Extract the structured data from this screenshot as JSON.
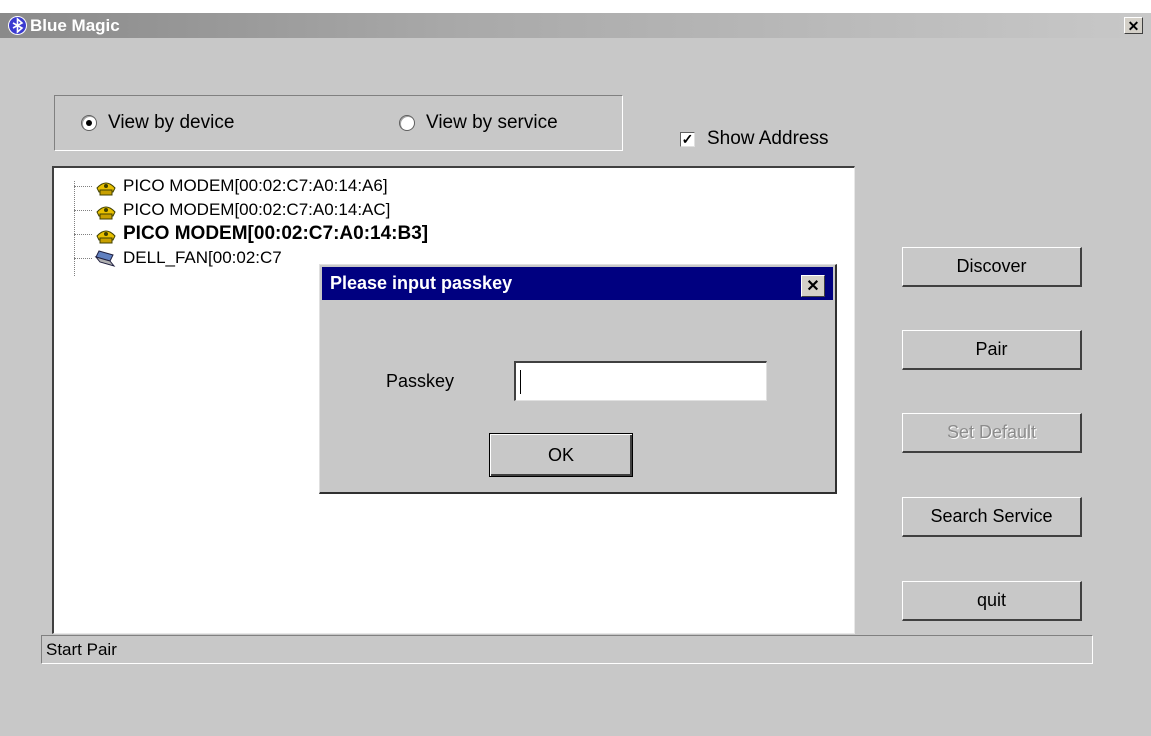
{
  "window": {
    "title": "Blue Magic",
    "close_label": "✕"
  },
  "view_options": {
    "by_device": "View by device",
    "by_service": "View by service",
    "selected": "View by device"
  },
  "show_address": {
    "label": "Show Address",
    "checked": true,
    "mark": "✓"
  },
  "devices": [
    {
      "label": "PICO MODEM[00:02:C7:A0:14:A6]",
      "icon": "modem-icon",
      "bold": false
    },
    {
      "label": "PICO MODEM[00:02:C7:A0:14:AC]",
      "icon": "modem-icon",
      "bold": false
    },
    {
      "label": "PICO MODEM[00:02:C7:A0:14:B3]",
      "icon": "modem-icon",
      "bold": true
    },
    {
      "label": "DELL_FAN[00:02:C7",
      "icon": "laptop-icon",
      "bold": false
    }
  ],
  "buttons": {
    "discover": "Discover",
    "pair": "Pair",
    "set_default": "Set Default",
    "search_service": "Search Service",
    "quit": "quit"
  },
  "status": {
    "text": "Start Pair"
  },
  "dialog": {
    "title": "Please input passkey",
    "close_label": "✕",
    "passkey_label": "Passkey",
    "passkey_value": "",
    "ok_label": "OK"
  },
  "colors": {
    "dialog_titlebar": "#000080",
    "window_bg": "#c8c8c8",
    "modem_icon": "#e8c000"
  }
}
